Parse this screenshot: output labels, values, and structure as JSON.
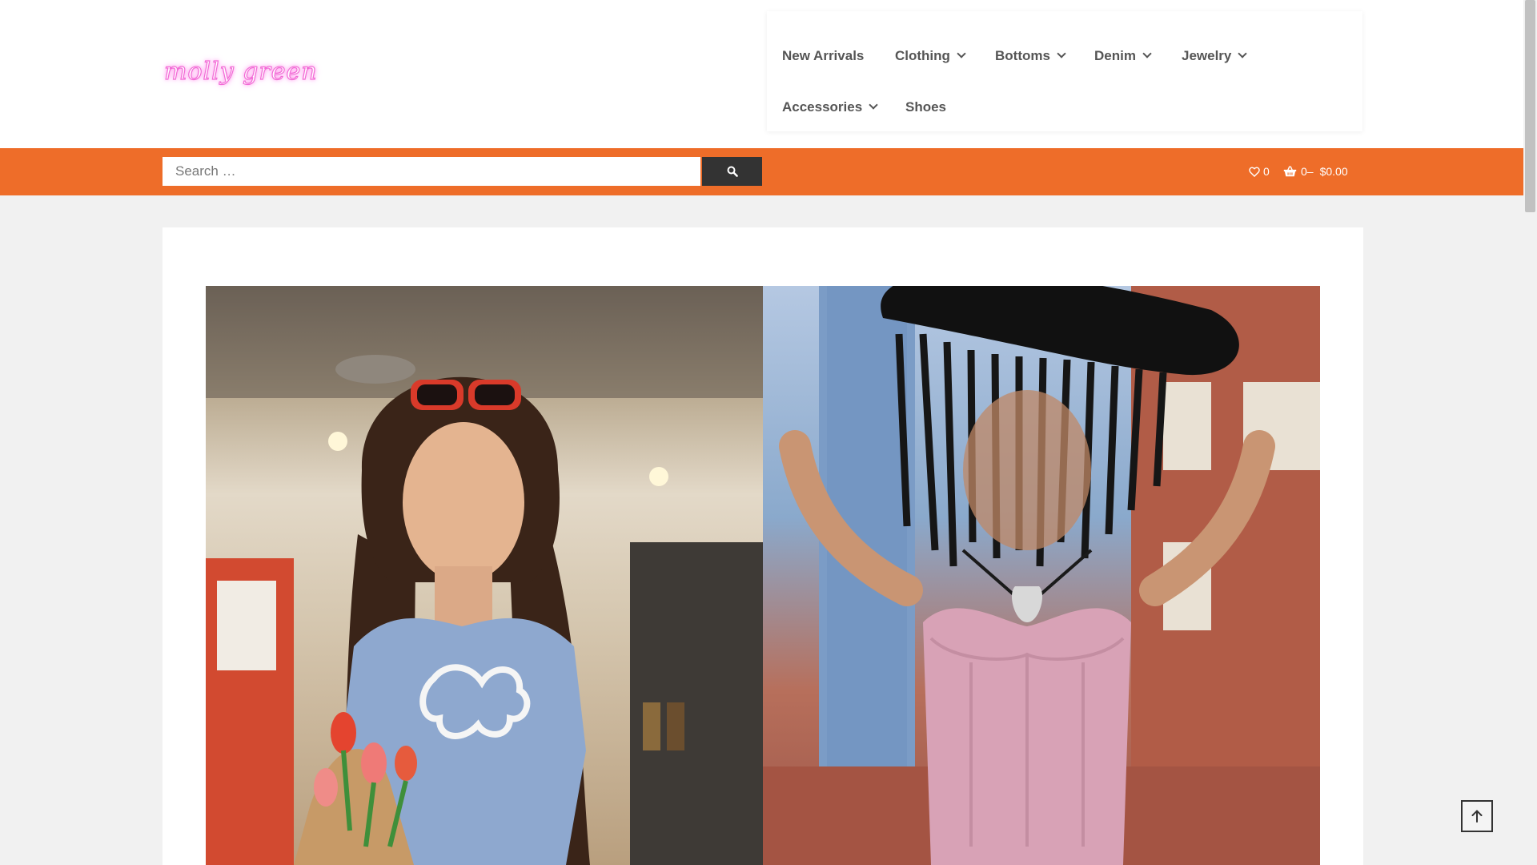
{
  "logo": {
    "text": "molly green"
  },
  "nav": {
    "items": [
      {
        "label": "New Arrivals"
      },
      {
        "label": "Clothing"
      },
      {
        "label": "Bottoms"
      },
      {
        "label": "Denim"
      },
      {
        "label": "Jewelry"
      },
      {
        "label": "Accessories"
      },
      {
        "label": "Shoes"
      }
    ]
  },
  "search": {
    "placeholder": "Search …"
  },
  "wishlist": {
    "count": "0"
  },
  "cart": {
    "count": "0",
    "separator": "–",
    "total": "$0.00"
  },
  "colors": {
    "accent": "#ee6d29",
    "logo": "#f26bd6",
    "nav_text": "#555555",
    "button": "#333333"
  },
  "icons": {
    "search": "search-icon",
    "wishlist": "heart-icon",
    "cart": "basket-icon",
    "to_top": "arrow-up-icon"
  }
}
